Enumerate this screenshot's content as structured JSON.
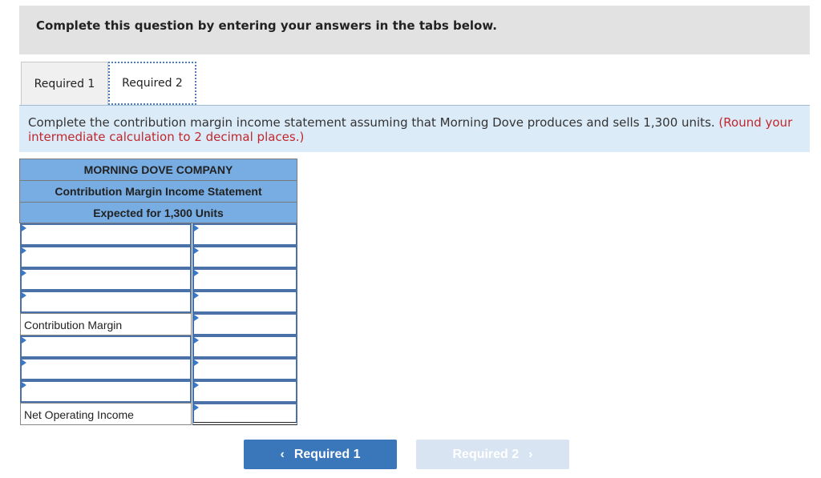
{
  "header": {
    "text": "Complete this question by entering your answers in the tabs below."
  },
  "tabs": [
    {
      "label": "Required 1"
    },
    {
      "label": "Required 2"
    }
  ],
  "instruction": {
    "text": "Complete the contribution margin income statement assuming that Morning Dove produces and sells 1,300 units. ",
    "note": "(Round your intermediate calculation to 2 decimal places.)"
  },
  "statement": {
    "company": "MORNING DOVE COMPANY",
    "title": "Contribution Margin Income Statement",
    "subtitle": "Expected for 1,300 Units",
    "labels": {
      "contribution_margin": "Contribution Margin",
      "net_operating_income": "Net Operating Income"
    }
  },
  "nav": {
    "prev_label": "Required 1",
    "next_label": "Required 2",
    "prev_icon": "‹",
    "next_icon": "›"
  }
}
